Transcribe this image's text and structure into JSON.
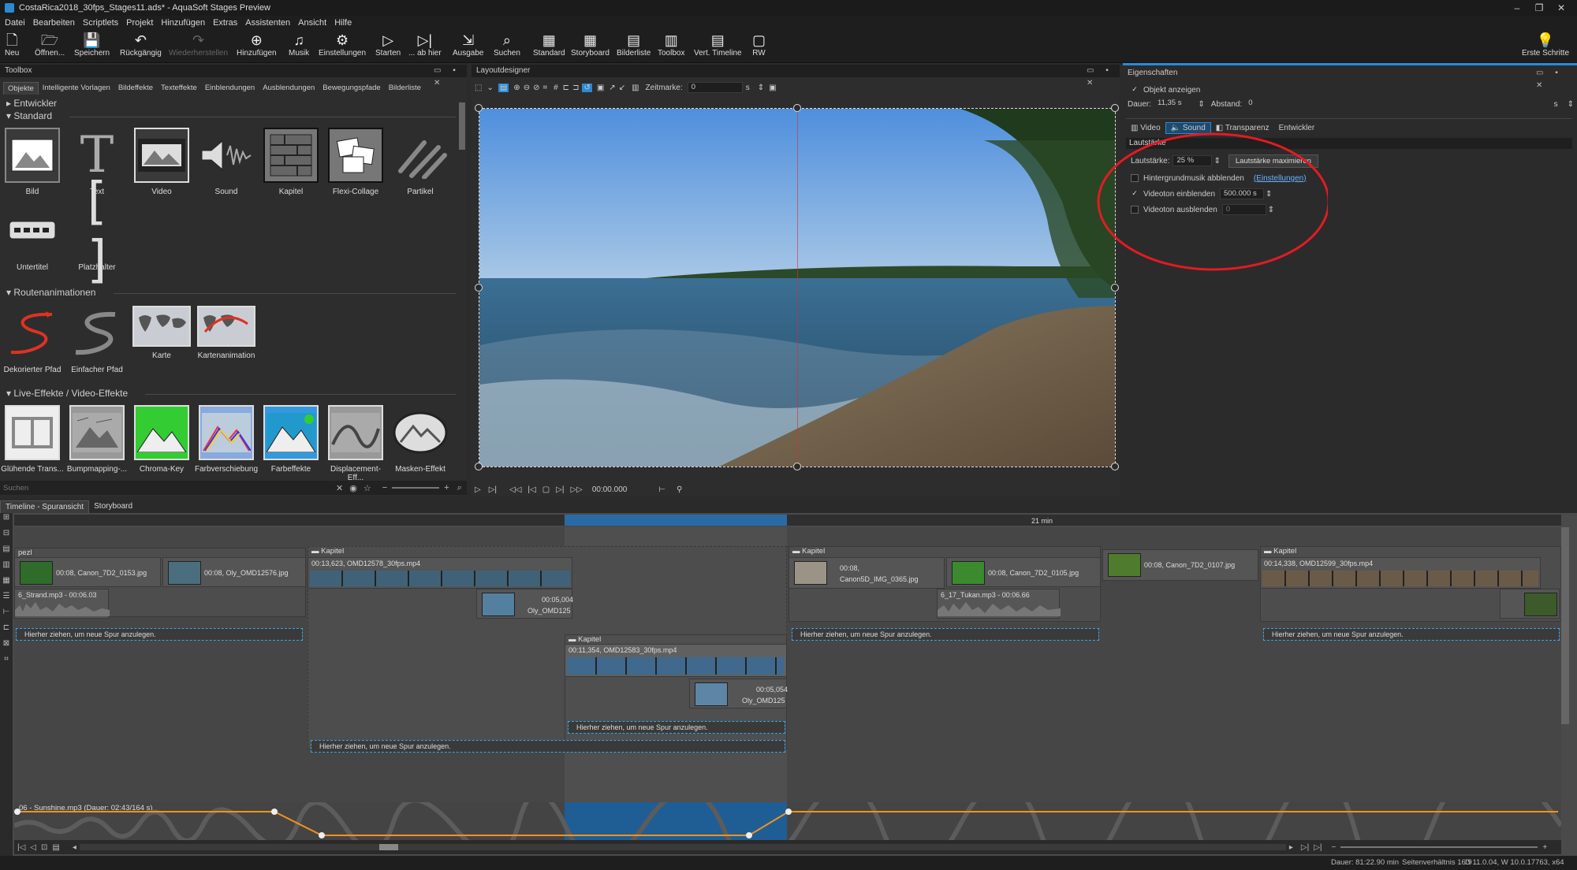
{
  "window": {
    "title": "CostaRica2018_30fps_Stages11.ads* - AquaSoft Stages Preview",
    "min": "–",
    "max": "❐",
    "close": "✕"
  },
  "menu": [
    "Datei",
    "Bearbeiten",
    "Scriptlets",
    "Projekt",
    "Hinzufügen",
    "Extras",
    "Assistenten",
    "Ansicht",
    "Hilfe"
  ],
  "ribbon": {
    "buttons": [
      {
        "label": "Neu",
        "icon": "new-doc-icon",
        "glyph": "🗋"
      },
      {
        "label": "Öffnen...",
        "icon": "open-icon",
        "glyph": "🗁"
      },
      {
        "label": "Speichern",
        "icon": "save-icon",
        "glyph": "💾"
      },
      {
        "label": "Rückgängig",
        "icon": "undo-icon",
        "glyph": "↶"
      },
      {
        "label": "Wiederherstellen",
        "icon": "redo-icon",
        "glyph": "↷"
      },
      {
        "label": "Hinzufügen",
        "icon": "add-icon",
        "glyph": "⊕"
      },
      {
        "label": "Musik",
        "icon": "music-icon",
        "glyph": "♫"
      },
      {
        "label": "Einstellungen",
        "icon": "settings-icon",
        "glyph": "⚙"
      },
      {
        "label": "Starten",
        "icon": "play-icon",
        "glyph": "▷"
      },
      {
        "label": "... ab hier",
        "icon": "play-from-here-icon",
        "glyph": "▷|"
      },
      {
        "label": "Ausgabe",
        "icon": "export-icon",
        "glyph": "⇲"
      },
      {
        "label": "Suchen",
        "icon": "search-icon",
        "glyph": "⌕"
      },
      {
        "label": "Standard",
        "icon": "standard-layout-icon",
        "glyph": "▦"
      },
      {
        "label": "Storyboard",
        "icon": "storyboard-icon",
        "glyph": "▦"
      },
      {
        "label": "Bilderliste",
        "icon": "imagelist-icon",
        "glyph": "▤"
      },
      {
        "label": "Toolbox",
        "icon": "toolbox-icon",
        "glyph": "▥"
      },
      {
        "label": "Vert. Timeline",
        "icon": "vertical-timeline-icon",
        "glyph": "▤"
      },
      {
        "label": "RW",
        "icon": "rw-icon",
        "glyph": "▢"
      }
    ],
    "first_steps": "Erste Schritte"
  },
  "toolbox": {
    "title": "Toolbox",
    "tabs": [
      "Objekte",
      "Intelligente Vorlagen",
      "Bildeffekte",
      "Texteffekte",
      "Einblendungen",
      "Ausblendungen",
      "Bewegungspfade",
      "Bilderliste"
    ],
    "sections": {
      "entwickler": "Entwickler",
      "standard": "Standard",
      "routen": "Routenanimationen",
      "live": "Live-Effekte / Video-Effekte"
    },
    "standard_items": [
      "Bild",
      "Text",
      "Video",
      "Sound",
      "Kapitel",
      "Flexi-Collage",
      "Partikel",
      "Untertitel",
      "Platzhalter"
    ],
    "route_items": [
      "Dekorierter Pfad",
      "Einfacher Pfad",
      "Karte",
      "Kartenanimation"
    ],
    "live_items": [
      "Glühende Trans...",
      "Bumpmapping-...",
      "Chroma-Key",
      "Farbverschiebung",
      "Farbeffekte",
      "Displacement-Eff...",
      "Masken-Effekt"
    ],
    "search_placeholder": "Suchen"
  },
  "layout": {
    "title": "Layoutdesigner",
    "zeitmarke_label": "Zeitmarke:",
    "zeitmarke_value": "0",
    "unit": "s",
    "time": "00:00.000"
  },
  "props": {
    "title": "Eigenschaften",
    "show_object": "Objekt anzeigen",
    "dauer_label": "Dauer:",
    "dauer_value": "11,35 s",
    "abstand_label": "Abstand:",
    "abstand_value": "0",
    "abstand_unit": "s",
    "tabs": [
      "Video",
      "Sound",
      "Transparenz",
      "Entwickler"
    ],
    "section": "Lautstärke",
    "volume_label": "Lautstärke:",
    "volume_value": "25 %",
    "maximize": "Lautstärke maximieren",
    "bgmusic": "Hintergrundmusik abblenden",
    "bgmusic_link": "(Einstellungen)",
    "fadein": "Videoton einblenden",
    "fadein_value": "500.000 s",
    "fadeout": "Videoton ausblenden",
    "fadeout_value": "0"
  },
  "timeline": {
    "tabs": [
      "Timeline - Spuransicht",
      "Storyboard"
    ],
    "ruler_marker": "21 min",
    "chapter_label": "Kapitel",
    "dropzone": "Hierher ziehen, um neue Spur anzulegen.",
    "clips": {
      "c1": "00:08,  Canon_7D2_0153.jpg",
      "c2": "00:08,  Oly_OMD12576.jpg",
      "c3": "00:13,623,  OMD12578_30fps.mp4",
      "c4a": "00:05,004",
      "c4b": "Oly_OMD125",
      "c5": "00:11,354,  OMD12583_30fps.mp4",
      "c6a": "00:05,054",
      "c6b": "Oly_OMD125",
      "c7a": "00:08,",
      "c7b": "Canon5D_IMG_0365.jpg",
      "c8": "00:08,  Canon_7D2_0105.jpg",
      "c9": "00:08,  Canon_7D2_0107.jpg",
      "c10": "00:14,338,  OMD12599_30fps.mp4",
      "a1": "6_Strand.mp3 - 00:06.03",
      "a2": "6_17_Tukan.mp3 - 00:06.66",
      "music": "06 - Sunshine.mp3 (Dauer: 02:43/164 s)",
      "pezl": "pezl"
    }
  },
  "status": {
    "dauer": "Dauer: 81:22.90 min",
    "seitenverhaeltnis": "Seitenverhältnis 16:9",
    "version": "D 11.0.04, W 10.0.17763, x64"
  }
}
